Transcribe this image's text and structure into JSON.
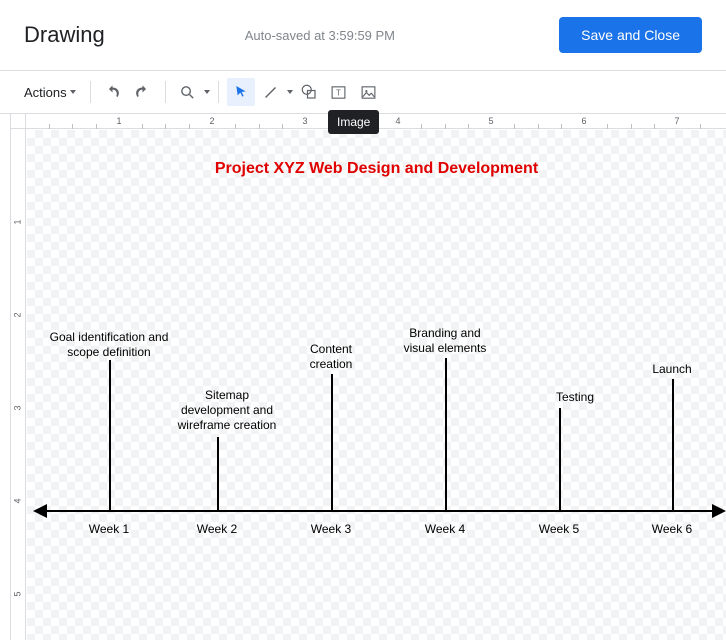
{
  "header": {
    "title": "Drawing",
    "autosave": "Auto-saved at 3:59:59 PM",
    "save_close": "Save and Close"
  },
  "toolbar": {
    "actions": "Actions",
    "tooltip_image": "Image"
  },
  "ruler_h": [
    "1",
    "2",
    "3",
    "4",
    "5",
    "6",
    "7"
  ],
  "ruler_v": [
    "1",
    "2",
    "3",
    "4",
    "5"
  ],
  "canvas": {
    "title": "Project XYZ Web Design and Development",
    "weeks": [
      "Week 1",
      "Week 2",
      "Week 3",
      "Week 4",
      "Week 5",
      "Week 6"
    ],
    "milestones": [
      {
        "label": "Goal identification and\nscope definition"
      },
      {
        "label": "Sitemap\ndevelopment and\nwireframe creation"
      },
      {
        "label": "Content\ncreation"
      },
      {
        "label": "Branding and\nvisual elements"
      },
      {
        "label": "Testing"
      },
      {
        "label": "Launch"
      }
    ]
  }
}
